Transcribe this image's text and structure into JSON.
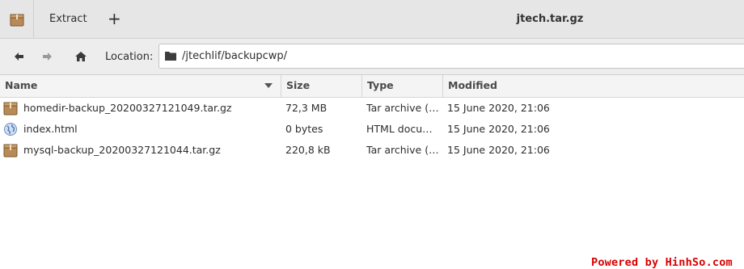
{
  "window": {
    "title": "jtech.tar.gz"
  },
  "titlebar": {
    "app_icon": "archive-package-icon",
    "extract_label": "Extract",
    "add_label": "+"
  },
  "toolbar": {
    "back_icon": "back-arrow-icon",
    "forward_icon": "forward-arrow-icon",
    "home_icon": "home-icon",
    "location_label": "Location:",
    "location_value": "/jtechlif/backupcwp/"
  },
  "columns": {
    "name": "Name",
    "size": "Size",
    "type": "Type",
    "modified": "Modified"
  },
  "files": [
    {
      "name": "homedir-backup_20200327121049.tar.gz",
      "size": "72,3 MB",
      "type": "Tar archive (…",
      "modified": "15 June 2020, 21:06",
      "icon": "archive-icon"
    },
    {
      "name": "index.html",
      "size": "0 bytes",
      "type": "HTML docu…",
      "modified": "15 June 2020, 21:06",
      "icon": "html-globe-icon"
    },
    {
      "name": "mysql-backup_20200327121044.tar.gz",
      "size": "220,8 kB",
      "type": "Tar archive (…",
      "modified": "15 June 2020, 21:06",
      "icon": "archive-icon"
    }
  ],
  "watermark": "Powered by HinhSo.com"
}
